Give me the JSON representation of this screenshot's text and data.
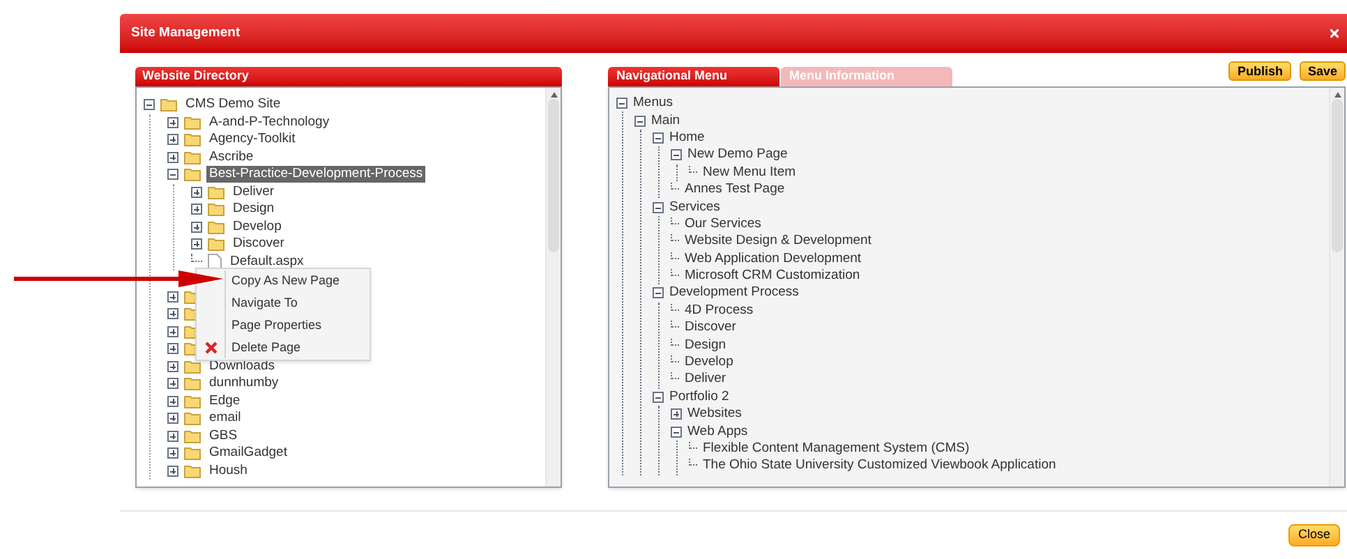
{
  "dialog": {
    "title": "Site Management"
  },
  "directory": {
    "title": "Website Directory",
    "tree": [
      {
        "label": "CMS Demo Site",
        "kind": "folder",
        "expanded": true,
        "selected": false,
        "children": [
          {
            "label": "A-and-P-Technology",
            "kind": "folder",
            "expanded": false,
            "selected": false
          },
          {
            "label": "Agency-Toolkit",
            "kind": "folder",
            "expanded": false,
            "selected": false
          },
          {
            "label": "Ascribe",
            "kind": "folder",
            "expanded": false,
            "selected": false
          },
          {
            "label": "Best-Practice-Development-Process",
            "kind": "folder",
            "expanded": true,
            "selected": true,
            "children": [
              {
                "label": "Deliver",
                "kind": "folder",
                "expanded": false,
                "selected": false
              },
              {
                "label": "Design",
                "kind": "folder",
                "expanded": false,
                "selected": false
              },
              {
                "label": "Develop",
                "kind": "folder",
                "expanded": false,
                "selected": false
              },
              {
                "label": "Discover",
                "kind": "folder",
                "expanded": false,
                "selected": false
              },
              {
                "label": "Default.aspx",
                "kind": "file",
                "selected": false
              }
            ]
          },
          {
            "kind": "covered"
          },
          {
            "kind": "folder",
            "expanded": false
          },
          {
            "kind": "folder",
            "expanded": false
          },
          {
            "kind": "folder",
            "expanded": false
          },
          {
            "kind": "folder",
            "expanded": false
          },
          {
            "label": "Downloads",
            "kind": "folder",
            "expanded": false,
            "selected": false
          },
          {
            "label": "dunnhumby",
            "kind": "folder",
            "expanded": false,
            "selected": false
          },
          {
            "label": "Edge",
            "kind": "folder",
            "expanded": false,
            "selected": false
          },
          {
            "label": "email",
            "kind": "folder",
            "expanded": false,
            "selected": false
          },
          {
            "label": "GBS",
            "kind": "folder",
            "expanded": false,
            "selected": false
          },
          {
            "label": "GmailGadget",
            "kind": "folder",
            "expanded": false,
            "selected": false
          },
          {
            "label": "Housh",
            "kind": "folder",
            "expanded": false,
            "selected": false
          }
        ]
      }
    ]
  },
  "context_menu": [
    {
      "label": "Copy As New Page",
      "kind": "plain"
    },
    {
      "label": "Navigate To",
      "kind": "plain"
    },
    {
      "label": "Page Properties",
      "kind": "plain"
    },
    {
      "label": "Delete Page",
      "kind": "delete"
    }
  ],
  "tabs": [
    {
      "label": "Navigational Menu",
      "selected": true
    },
    {
      "label": "Menu Information",
      "selected": false
    }
  ],
  "buttons": [
    "Publish",
    "Save"
  ],
  "menu_tree": [
    {
      "label": "Menus",
      "expanded": true,
      "children": [
        {
          "label": "Main",
          "expanded": true,
          "children": [
            {
              "label": "Home",
              "expanded": true,
              "children": [
                {
                  "label": "New Demo Page",
                  "expanded": true,
                  "children": [
                    {
                      "label": "New Menu Item"
                    }
                  ]
                },
                {
                  "label": "Annes Test Page"
                }
              ]
            },
            {
              "label": "Services",
              "expanded": true,
              "children": [
                {
                  "label": "Our Services"
                },
                {
                  "label": "Website Design & Development"
                },
                {
                  "label": "Web Application Development"
                },
                {
                  "label": "Microsoft CRM Customization"
                }
              ]
            },
            {
              "label": "Development Process",
              "expanded": true,
              "children": [
                {
                  "label": "4D Process"
                },
                {
                  "label": "Discover"
                },
                {
                  "label": "Design"
                },
                {
                  "label": "Develop"
                },
                {
                  "label": "Deliver"
                }
              ]
            },
            {
              "label": "Portfolio 2",
              "expanded": true,
              "children": [
                {
                  "label": "Websites",
                  "expanded": false
                },
                {
                  "label": "Web Apps",
                  "expanded": true,
                  "children": [
                    {
                      "label": "Flexible Content Management System (CMS)"
                    },
                    {
                      "label": "The Ohio State University Customized Viewbook Application"
                    }
                  ]
                }
              ]
            }
          ]
        }
      ]
    }
  ],
  "footer": {
    "button": "Close"
  }
}
